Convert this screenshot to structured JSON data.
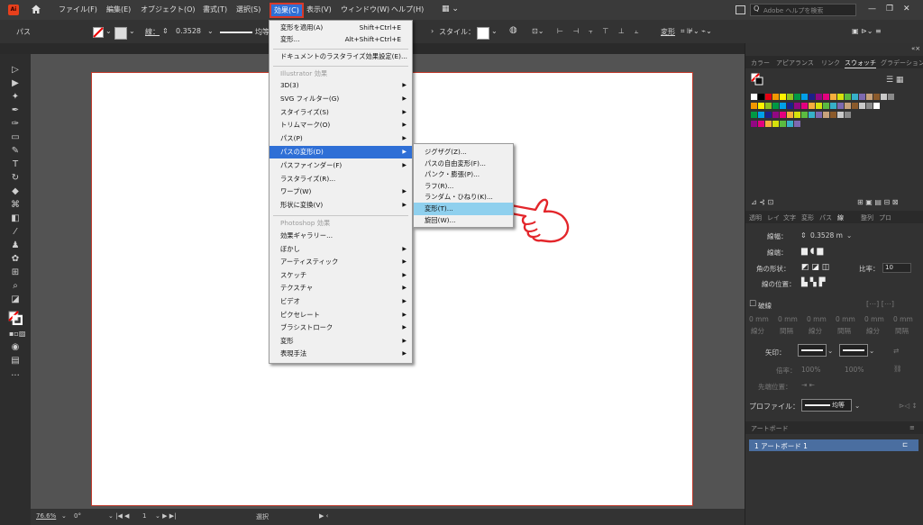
{
  "menubar": {
    "logo": "Ai",
    "items": [
      "ファイル(F)",
      "編集(E)",
      "オブジェクト(O)",
      "書式(T)",
      "選択(S)",
      "効果(C)",
      "表示(V)",
      "ウィンドウ(W)",
      "ヘルプ(H)"
    ],
    "active_item": "効果(C)",
    "search_placeholder": "Adobe ヘルプを検索"
  },
  "controlbar": {
    "object_type": "パス",
    "stroke_label": "線：",
    "stroke_weight": "0.3528",
    "profile_label": "均等",
    "style_label": "スタイル：",
    "transform_label": "変形"
  },
  "effect_menu": {
    "apply_last": {
      "label": "変形を適用(A)",
      "shortcut": "Shift+Ctrl+E"
    },
    "last_effect": {
      "label": "変形...",
      "shortcut": "Alt+Shift+Ctrl+E"
    },
    "raster_settings": "ドキュメントのラスタライズ効果設定(E)...",
    "illustrator_heading": "Illustrator 効果",
    "illustrator_items": [
      "3D(3)",
      "SVG フィルター(G)",
      "スタイライズ(S)",
      "トリムマーク(O)",
      "パス(P)",
      "パスの変形(D)",
      "パスファインダー(F)",
      "ラスタライズ(R)...",
      "ワープ(W)",
      "形状に変換(V)"
    ],
    "photoshop_heading": "Photoshop 効果",
    "photoshop_items": [
      "効果ギャラリー...",
      "ぼかし",
      "アーティスティック",
      "スケッチ",
      "テクスチャ",
      "ビデオ",
      "ピクセレート",
      "ブラシストローク",
      "変形",
      "表現手法"
    ],
    "highlighted": "パスの変形(D)"
  },
  "distort_submenu": {
    "items": [
      "ジグザグ(Z)...",
      "パスの自由変形(F)...",
      "パンク・膨張(P)...",
      "ラフ(R)...",
      "ランダム・ひねり(K)...",
      "変形(T)...",
      "旋回(W)..."
    ],
    "highlighted": "変形(T)..."
  },
  "right_panel": {
    "top_tabs": [
      "カラー",
      "アピアランス",
      "リンク",
      "スウォッチ",
      "グラデーション"
    ],
    "active_top_tab": "スウォッチ",
    "stroke_tabs": [
      "透明",
      "レイ",
      "文字",
      "変形",
      "パス",
      "線",
      "整列",
      "プロ"
    ],
    "active_stroke_tab": "線",
    "weight_label": "線幅：",
    "weight_value": "0.3528 m",
    "cap_label": "線端：",
    "corner_label": "角の形状：",
    "limit_label": "比率：",
    "limit_value": "10",
    "align_label": "線の位置：",
    "dashed_label": "破線",
    "dash_fields": [
      "0 mm",
      "0 mm",
      "0 mm",
      "0 mm",
      "0 mm",
      "0 mm"
    ],
    "dash_labels": [
      "線分",
      "間隔",
      "線分",
      "間隔",
      "線分",
      "間隔"
    ],
    "arrow_label": "矢印：",
    "scale_label": "倍率：",
    "scale_values": [
      "100%",
      "100%"
    ],
    "align_arrow_label": "先端位置：",
    "profile_label": "プロファイル：",
    "profile_value": "均等",
    "artboards_title": "アートボード",
    "artboard_item": "1    アートボード 1"
  },
  "statusbar": {
    "zoom": "76.6%",
    "rotation": "0°",
    "page": "1",
    "tool": "選択"
  },
  "swatch_colors": [
    "#ffffff",
    "#000000",
    "#e60012",
    "#f39800",
    "#fff100",
    "#8fc31f",
    "#009944",
    "#00a0e9",
    "#1d2088",
    "#920783",
    "#e4007f",
    "#f6ae3d",
    "#d6e10c",
    "#5bbb40",
    "#36b0c9",
    "#7d69b0",
    "#c7a27c",
    "#8b5a2b",
    "#c9c9c9",
    "#8a8a8a"
  ],
  "accent": "#2f6fd6"
}
